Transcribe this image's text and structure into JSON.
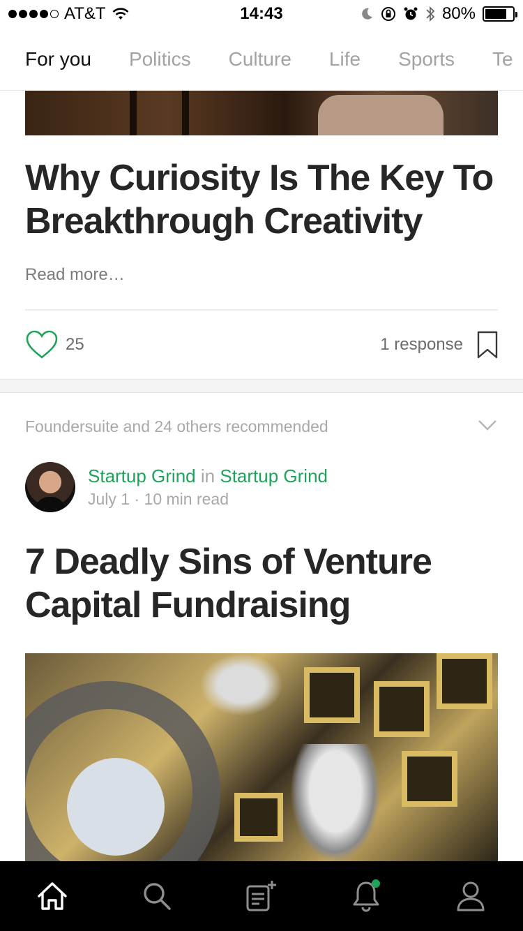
{
  "status_bar": {
    "carrier": "AT&T",
    "time": "14:43",
    "battery": "80%",
    "battery_level": 0.8
  },
  "tabs": [
    {
      "label": "For you",
      "active": true
    },
    {
      "label": "Politics",
      "active": false
    },
    {
      "label": "Culture",
      "active": false
    },
    {
      "label": "Life",
      "active": false
    },
    {
      "label": "Sports",
      "active": false
    },
    {
      "label": "Te",
      "active": false
    }
  ],
  "post1": {
    "title": "Why Curiosity Is The Key To Breakthrough Creativity",
    "read_more": "Read more…",
    "claps": "25",
    "responses": "1 response"
  },
  "post2": {
    "recommended_by": "Foundersuite and 24 others recommended",
    "author": "Startup Grind",
    "connector": "in",
    "publication": "Startup Grind",
    "date": "July 1",
    "separator": "·",
    "read_time": "10 min read",
    "title": "7 Deadly Sins of Venture Capital Fundraising"
  },
  "nav": {
    "items": [
      {
        "icon": "home-icon"
      },
      {
        "icon": "search-icon"
      },
      {
        "icon": "write-icon"
      },
      {
        "icon": "bell-icon"
      },
      {
        "icon": "profile-icon"
      }
    ]
  },
  "colors": {
    "accent": "#1fa35a",
    "nav_bg": "#000000"
  }
}
